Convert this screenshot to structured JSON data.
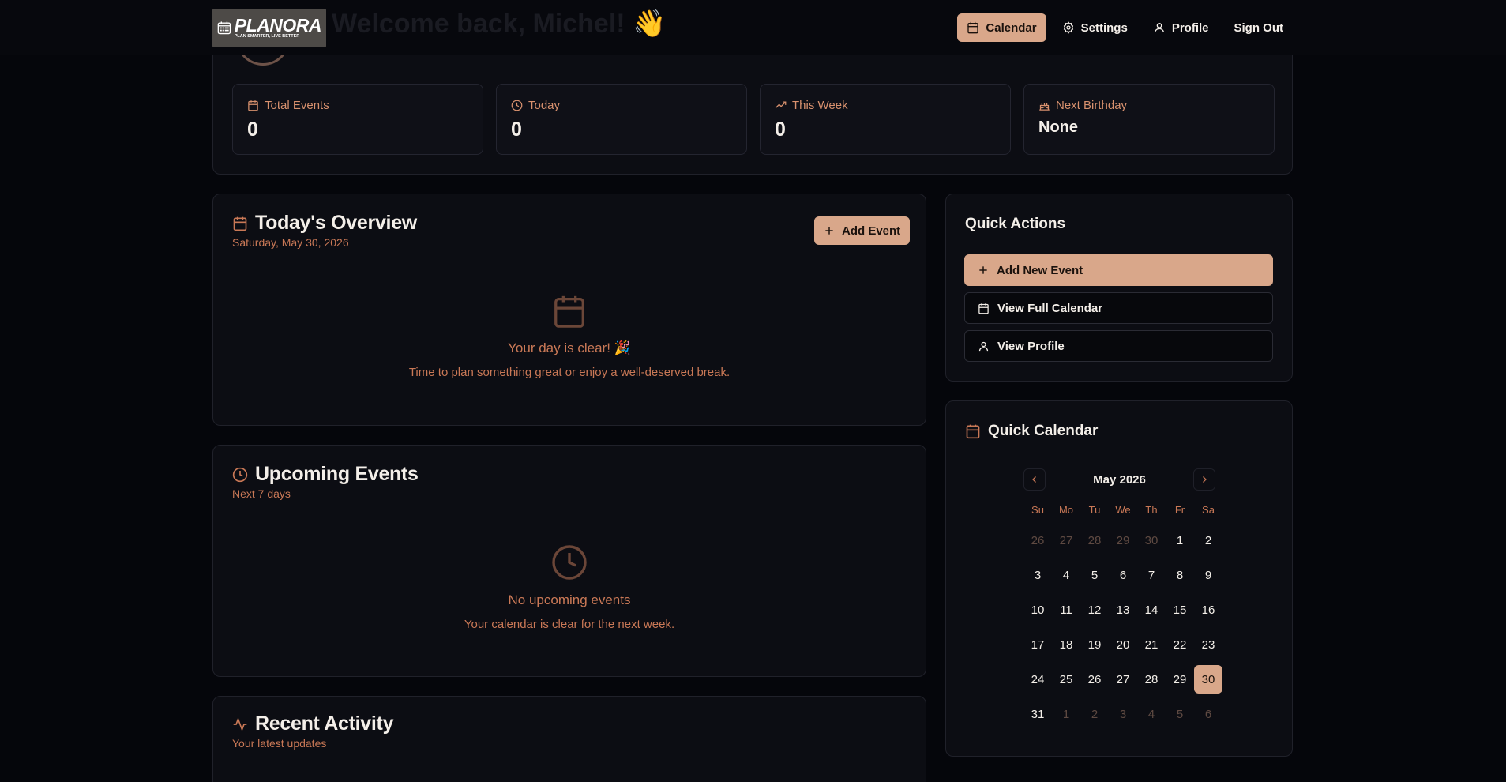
{
  "header": {
    "logo_name": "PLANORA",
    "logo_tagline": "PLAN SMARTER, LIVE BETTER",
    "faded_welcome": "Welcome back, Michel! 👋",
    "nav": [
      {
        "label": "Calendar",
        "icon": "calendar-icon",
        "active": true
      },
      {
        "label": "Settings",
        "icon": "gear-icon",
        "active": false
      },
      {
        "label": "Profile",
        "icon": "user-icon",
        "active": false
      },
      {
        "label": "Sign Out",
        "icon": "",
        "active": false
      }
    ]
  },
  "stats": [
    {
      "label": "Total Events",
      "value": "0",
      "icon": "calendar-icon"
    },
    {
      "label": "Today",
      "value": "0",
      "icon": "clock-icon"
    },
    {
      "label": "This Week",
      "value": "0",
      "icon": "trending-up-icon"
    },
    {
      "label": "Next Birthday",
      "value": "None",
      "icon": "cake-icon"
    }
  ],
  "today": {
    "title": "Today's Overview",
    "date": "Saturday, May 30, 2026",
    "add_button": "Add Event",
    "empty_title": "Your day is clear! 🎉",
    "empty_text": "Time to plan something great or enjoy a well-deserved break."
  },
  "upcoming": {
    "title": "Upcoming Events",
    "subtitle": "Next 7 days",
    "empty_title": "No upcoming events",
    "empty_text": "Your calendar is clear for the next week."
  },
  "activity": {
    "title": "Recent Activity",
    "subtitle": "Your latest updates"
  },
  "quick_actions": {
    "title": "Quick Actions",
    "buttons": [
      "Add New Event",
      "View Full Calendar",
      "View Profile"
    ]
  },
  "quick_calendar": {
    "title": "Quick Calendar",
    "month": "May 2026",
    "weekdays": [
      "Su",
      "Mo",
      "Tu",
      "We",
      "Th",
      "Fr",
      "Sa"
    ],
    "weeks": [
      [
        "26",
        "27",
        "28",
        "29",
        "30",
        "1",
        "2"
      ],
      [
        "3",
        "4",
        "5",
        "6",
        "7",
        "8",
        "9"
      ],
      [
        "10",
        "11",
        "12",
        "13",
        "14",
        "15",
        "16"
      ],
      [
        "17",
        "18",
        "19",
        "20",
        "21",
        "22",
        "23"
      ],
      [
        "24",
        "25",
        "26",
        "27",
        "28",
        "29",
        "30"
      ],
      [
        "31",
        "1",
        "2",
        "3",
        "4",
        "5",
        "6"
      ]
    ],
    "outside": [
      [
        0,
        0
      ],
      [
        0,
        1
      ],
      [
        0,
        2
      ],
      [
        0,
        3
      ],
      [
        0,
        4
      ],
      [
        5,
        1
      ],
      [
        5,
        2
      ],
      [
        5,
        3
      ],
      [
        5,
        4
      ],
      [
        5,
        5
      ],
      [
        5,
        6
      ]
    ],
    "selected": [
      4,
      6
    ]
  },
  "colors": {
    "accent": "#d9a78a",
    "muted_accent": "#c97856",
    "background": "#05060b"
  }
}
